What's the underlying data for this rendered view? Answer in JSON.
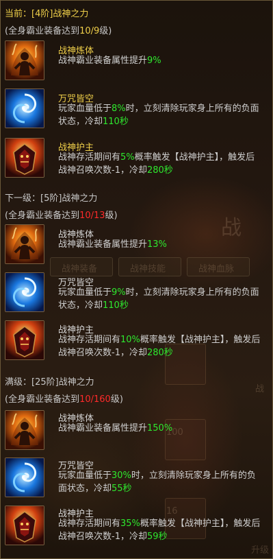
{
  "current": {
    "title": "当前：[4阶]战神之力",
    "requirement": {
      "pre": "(全身霸业装备达到",
      "value": "10/9",
      "post": "级)"
    },
    "skills": [
      {
        "name": "战神炼体",
        "icon": "warrior-flame-icon",
        "desc": [
          {
            "t": "战神霸业装备属性提升"
          },
          {
            "t": "9%",
            "c": "hl"
          }
        ]
      },
      {
        "name": "万咒皆空",
        "icon": "blue-vortex-icon",
        "desc": [
          {
            "t": "玩家血量低于"
          },
          {
            "t": "8%",
            "c": "hl"
          },
          {
            "t": "时，立刻清除玩家身上所有的负面状态，冷却"
          },
          {
            "t": "110秒",
            "c": "hl"
          }
        ]
      },
      {
        "name": "战神护主",
        "icon": "guardian-armor-icon",
        "desc": [
          {
            "t": "战神存活期间有"
          },
          {
            "t": "5%",
            "c": "hl"
          },
          {
            "t": "概率触发【战神护主】，触发后战神召唤次数-1，冷却"
          },
          {
            "t": "280秒",
            "c": "hl"
          }
        ]
      }
    ]
  },
  "next": {
    "title": "下一级：[5阶]战神之力",
    "requirement": {
      "pre": "(全身霸业装备达到",
      "value": "10/13",
      "post": "级)"
    },
    "skills": [
      {
        "name": "战神炼体",
        "icon": "warrior-flame-icon",
        "desc": [
          {
            "t": "战神霸业装备属性提升"
          },
          {
            "t": "13%",
            "c": "hl"
          }
        ]
      },
      {
        "name": "万咒皆空",
        "icon": "blue-vortex-icon",
        "desc": [
          {
            "t": "玩家血量低于"
          },
          {
            "t": "9%",
            "c": "hl"
          },
          {
            "t": "时，立刻清除玩家身上所有的负面状态，冷却"
          },
          {
            "t": "110秒",
            "c": "hl"
          }
        ]
      },
      {
        "name": "战神护主",
        "icon": "guardian-armor-icon",
        "desc": [
          {
            "t": "战神存活期间有"
          },
          {
            "t": "10%",
            "c": "hl"
          },
          {
            "t": "概率触发【战神护主】，触发后战神召唤次数-1，冷却"
          },
          {
            "t": "280秒",
            "c": "hl"
          }
        ]
      }
    ]
  },
  "max": {
    "title": "满级：[25阶]战神之力",
    "requirement": {
      "pre": "(全身霸业装备达到",
      "value": "10/160",
      "post": "级)"
    },
    "skills": [
      {
        "name": "战神炼体",
        "icon": "warrior-flame-icon",
        "desc": [
          {
            "t": "战神霸业装备属性提升"
          },
          {
            "t": "150%",
            "c": "hl"
          }
        ]
      },
      {
        "name": "万咒皆空",
        "icon": "blue-vortex-icon",
        "desc": [
          {
            "t": "玩家血量低于"
          },
          {
            "t": "30%",
            "c": "hl"
          },
          {
            "t": "时，立刻清除玩家身上所有的负面状态，冷却"
          },
          {
            "t": "55秒",
            "c": "hl"
          }
        ]
      },
      {
        "name": "战神护主",
        "icon": "guardian-armor-icon",
        "desc": [
          {
            "t": "战神存活期间有"
          },
          {
            "t": "35%",
            "c": "hl"
          },
          {
            "t": "概率触发【战神护主】，触发后战神召唤次数-1，冷却"
          },
          {
            "t": "59秒",
            "c": "hl"
          }
        ]
      }
    ]
  },
  "background": {
    "big_char": "战",
    "tabs": [
      "战神装备",
      "战神技能",
      "战神血脉"
    ],
    "side_char": "战",
    "numbers": [
      "100",
      "16"
    ],
    "upgrade": "升级"
  },
  "colors": {
    "current_title": "#f0d04a",
    "other_title": "#c8c8c8",
    "skill_name_current": "#f0d04a",
    "skill_name_other": "#d8d8d8",
    "highlight": "#2ee82e",
    "requirement_value": "#ff2a2a"
  }
}
